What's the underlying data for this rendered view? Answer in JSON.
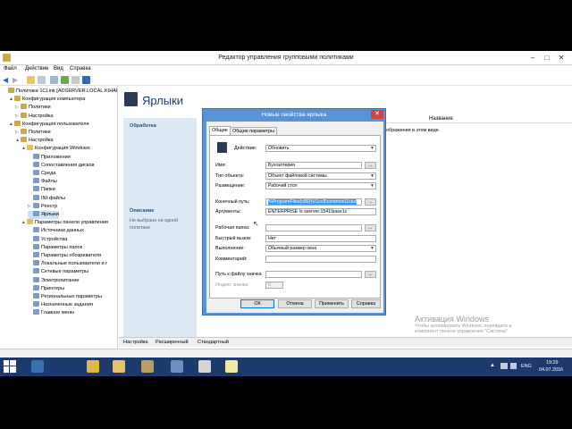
{
  "window": {
    "title": "Редактор управления групповыми политиками"
  },
  "menu": [
    "Файл",
    "Действие",
    "Вид",
    "Справка"
  ],
  "tree": [
    {
      "label": "Политика 1CLink [ADSERVER.LOCAL.KIHAI",
      "indent": 0,
      "arrow": ""
    },
    {
      "label": "Конфигурация компьютера",
      "indent": 1,
      "arrow": "▲"
    },
    {
      "label": "Политики",
      "indent": 2,
      "arrow": "▷"
    },
    {
      "label": "Настройка",
      "indent": 2,
      "arrow": "▷"
    },
    {
      "label": "Конфигурация пользователя",
      "indent": 1,
      "arrow": "▲"
    },
    {
      "label": "Политики",
      "indent": 2,
      "arrow": "▷"
    },
    {
      "label": "Настройка",
      "indent": 2,
      "arrow": "▲"
    },
    {
      "label": "Конфигурация Windows",
      "indent": 3,
      "arrow": "▲"
    },
    {
      "label": "Приложения",
      "indent": 4,
      "arrow": ""
    },
    {
      "label": "Сопоставления дисков",
      "indent": 4,
      "arrow": ""
    },
    {
      "label": "Среда",
      "indent": 4,
      "arrow": ""
    },
    {
      "label": "Файлы",
      "indent": 4,
      "arrow": ""
    },
    {
      "label": "Папки",
      "indent": 4,
      "arrow": ""
    },
    {
      "label": "INI-файлы",
      "indent": 4,
      "arrow": ""
    },
    {
      "label": "Реестр",
      "indent": 4,
      "arrow": "▷"
    },
    {
      "label": "Ярлыки",
      "indent": 4,
      "arrow": "",
      "selected": true
    },
    {
      "label": "Параметры панели управления",
      "indent": 3,
      "arrow": "▲"
    },
    {
      "label": "Источники данных",
      "indent": 4,
      "arrow": ""
    },
    {
      "label": "Устройства",
      "indent": 4,
      "arrow": ""
    },
    {
      "label": "Параметры папок",
      "indent": 4,
      "arrow": ""
    },
    {
      "label": "Параметры обозревателя",
      "indent": 4,
      "arrow": ""
    },
    {
      "label": "Локальные пользователи и г",
      "indent": 4,
      "arrow": ""
    },
    {
      "label": "Сетевые параметры",
      "indent": 4,
      "arrow": ""
    },
    {
      "label": "Электропитание",
      "indent": 4,
      "arrow": ""
    },
    {
      "label": "Принтеры",
      "indent": 4,
      "arrow": ""
    },
    {
      "label": "Региональные параметры",
      "indent": 4,
      "arrow": ""
    },
    {
      "label": "Назначенные задания",
      "indent": 4,
      "arrow": ""
    },
    {
      "label": "Главное меню",
      "indent": 4,
      "arrow": ""
    }
  ],
  "pane": {
    "title": "Ярлыки",
    "processing_label": "Обработка",
    "description_label": "Описание",
    "description_text_1": "Не выбрано ни одной",
    "description_text_2": "политики",
    "column_name": "Название",
    "empty_text": "ображения в этом виде."
  },
  "tabs": [
    "Настройка",
    "Расширенный",
    "Стандартный"
  ],
  "dialog": {
    "title": "Новые свойства ярлыка",
    "tab_general": "Общие",
    "tab_common": "Общие параметры",
    "action_label": "Действие:",
    "action_value": "Обновить",
    "name_label": "Имя:",
    "name_value": "Бухгалтерия",
    "target_type_label": "Тип объекта:",
    "target_type_value": "Объект файловой системы",
    "location_label": "Размещение:",
    "location_value": "Рабочий стол",
    "target_path_label": "Конечный путь:",
    "target_path_value": "%ProgramFiles(x86)%\\1cv8\\common\\1cest",
    "arguments_label": "Аргументы:",
    "arguments_value": "ENTERPRISE /s sserver:1541\\base1c",
    "start_in_label": "Рабочая папка:",
    "start_in_value": "",
    "shortcut_key_label": "Быстрый вызов:",
    "shortcut_key_value": "Нет",
    "run_label": "Выполнение:",
    "run_value": "Обычный размер окна",
    "comment_label": "Комментарий:",
    "comment_value": "",
    "icon_path_label": "Путь к файлу значка",
    "icon_path_value": "",
    "icon_index_label": "Индекс значка:",
    "icon_index_value": "0",
    "browse": "...",
    "ok": "ОК",
    "cancel": "Отмена",
    "apply": "Применить",
    "help": "Справка"
  },
  "watermark": {
    "title": "Активация Windows",
    "line1": "Чтобы активировать Windows, перейдите в",
    "line2": "компонент панели управления \"Система\""
  },
  "taskbar": {
    "time": "19:29",
    "date": "04.07.2016",
    "lang": "ENG"
  }
}
